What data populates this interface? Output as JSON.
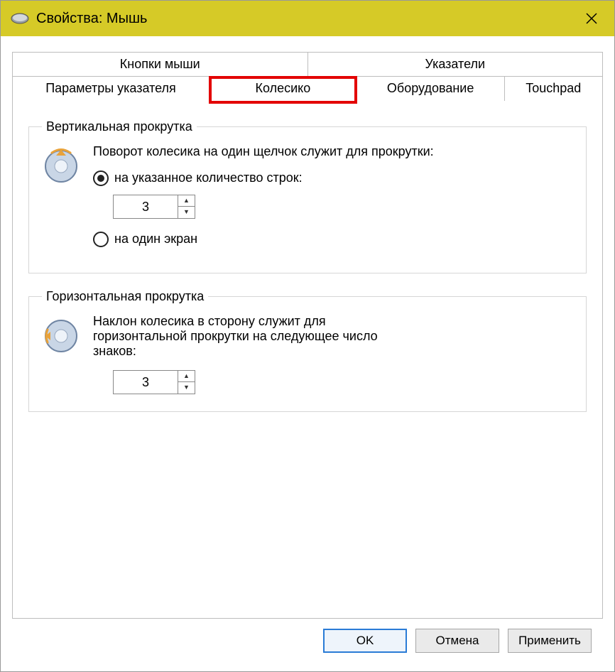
{
  "window": {
    "title": "Свойства: Мышь"
  },
  "tabs": {
    "row1": [
      "Кнопки мыши",
      "Указатели"
    ],
    "row2": [
      "Параметры указателя",
      "Колесико",
      "Оборудование",
      "Touchpad"
    ],
    "selected": "Колесико"
  },
  "vertical": {
    "legend": "Вертикальная прокрутка",
    "desc": "Поворот колесика на один щелчок служит для прокрутки:",
    "radio_lines": "на указанное количество строк:",
    "radio_screen": "на один экран",
    "value": "3"
  },
  "horizontal": {
    "legend": "Горизонтальная прокрутка",
    "desc": "Наклон колесика в сторону служит для горизонтальной прокрутки на следующее число знаков:",
    "value": "3"
  },
  "buttons": {
    "ok": "OK",
    "cancel": "Отмена",
    "apply": "Применить"
  }
}
